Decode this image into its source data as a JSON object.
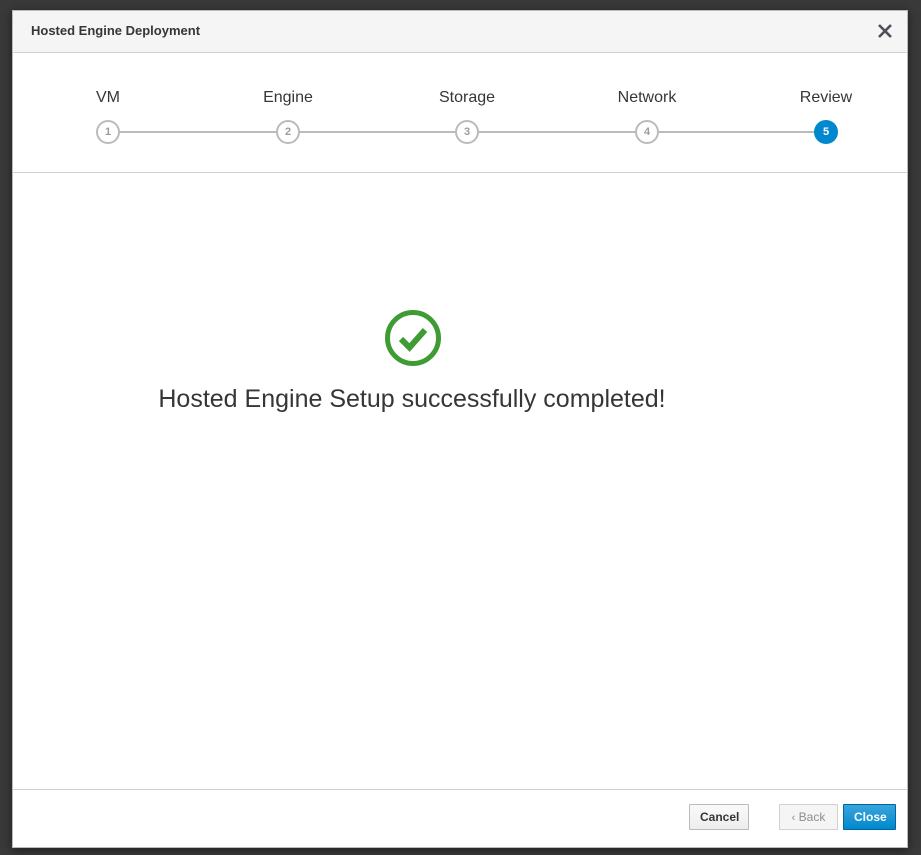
{
  "dialog": {
    "title": "Hosted Engine Deployment"
  },
  "wizard": {
    "steps": [
      {
        "number": "1",
        "label": "VM"
      },
      {
        "number": "2",
        "label": "Engine"
      },
      {
        "number": "3",
        "label": "Storage"
      },
      {
        "number": "4",
        "label": "Network"
      },
      {
        "number": "5",
        "label": "Review"
      }
    ],
    "active_step": "5"
  },
  "content": {
    "message": "Hosted Engine Setup successfully completed!",
    "icon": "check-circle-icon"
  },
  "footer": {
    "cancel_label": "Cancel",
    "back_label": "Back",
    "close_label": "Close"
  },
  "colors": {
    "accent": "#0088ce",
    "success": "#3f9c35",
    "text": "#363636"
  }
}
